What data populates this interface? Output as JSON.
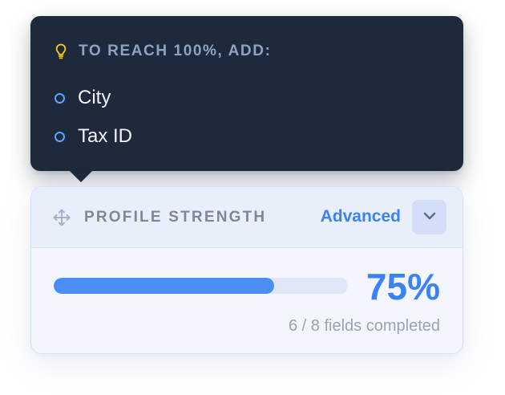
{
  "tooltip": {
    "title": "TO REACH 100%, ADD:",
    "icon": "lightbulb-icon",
    "items": [
      {
        "label": "City"
      },
      {
        "label": "Tax ID"
      }
    ]
  },
  "card": {
    "title": "PROFILE STRENGTH",
    "mode_label": "Advanced",
    "toggle_icon": "chevron-down-icon",
    "drag_icon": "move-icon",
    "progress_fraction": 0.75,
    "percent_label": "75%",
    "fields_summary": "6 / 8 fields completed"
  },
  "colors": {
    "accent": "#3b82f6",
    "tooltip_bg": "#1e293b",
    "bulb": "#facc15"
  }
}
